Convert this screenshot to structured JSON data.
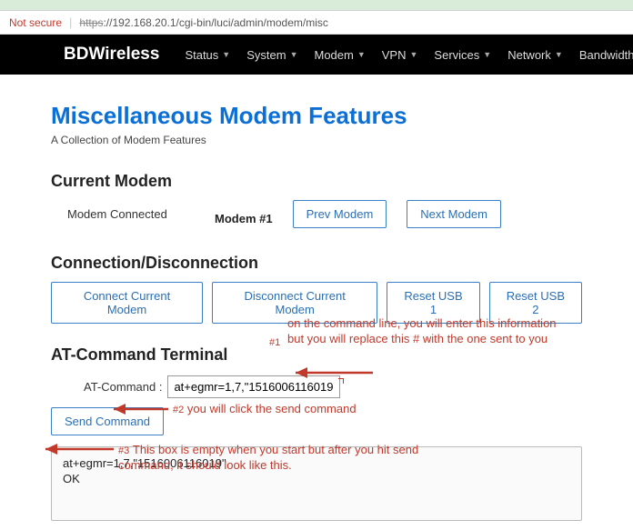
{
  "urlbar": {
    "secure_warn": "Not secure",
    "proto": "https",
    "path": "://192.168.20.1/cgi-bin/luci/admin/modem/misc"
  },
  "nav": {
    "brand": "BDWireless",
    "items": [
      "Status",
      "System",
      "Modem",
      "VPN",
      "Services",
      "Network",
      "Bandwidth"
    ]
  },
  "page": {
    "title": "Miscellaneous Modem Features",
    "subtitle": "A Collection of Modem Features"
  },
  "current_modem": {
    "heading": "Current Modem",
    "status": "Modem Connected",
    "label": "Modem #1",
    "prev_btn": "Prev Modem",
    "next_btn": "Next Modem"
  },
  "conn": {
    "heading": "Connection/Disconnection",
    "connect_btn": "Connect Current Modem",
    "disconnect_btn": "Disconnect Current Modem",
    "reset1_btn": "Reset USB 1",
    "reset2_btn": "Reset USB 2"
  },
  "at": {
    "heading": "AT-Command Terminal",
    "label": "AT-Command :",
    "input_value": "at+egmr=1,7,\"1516006116019\"",
    "send_btn": "Send Command",
    "term_line1": "at+egmr=1,7,\"1516006116019\"",
    "term_line2": "OK"
  },
  "annotations": {
    "a1_num": "#1",
    "a1_text": "on the command line, you will enter this information but you will replace this # with the one sent to you",
    "a2_num": "#2",
    "a2_text": "you will click the send command",
    "a3_num": "#3",
    "a3_text": "This box is empty when you start but after you hit send command, it should look like this."
  }
}
